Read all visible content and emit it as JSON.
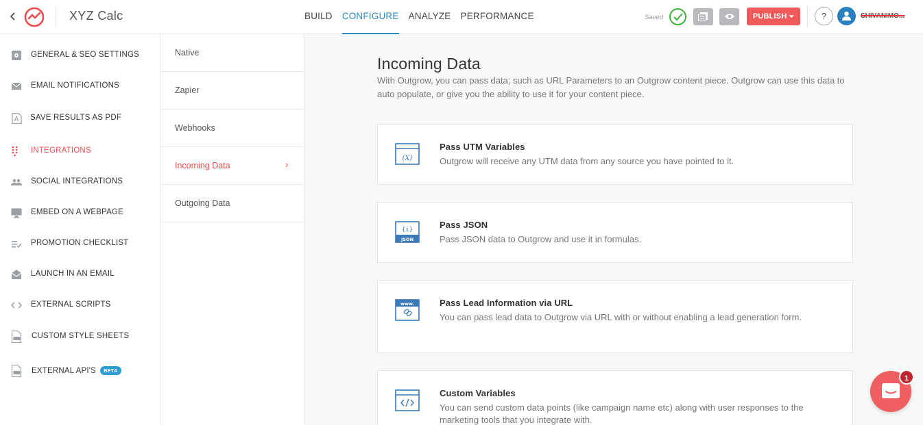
{
  "header": {
    "back_icon": "chevron-left-icon",
    "logo_icon": "outgrow-logo-icon",
    "app_title": "XYZ Calc",
    "tabs": [
      {
        "label": "BUILD",
        "active": false
      },
      {
        "label": "CONFIGURE",
        "active": true
      },
      {
        "label": "ANALYZE",
        "active": false
      },
      {
        "label": "PERFORMANCE",
        "active": false
      }
    ],
    "saved_label": "Saved",
    "publish_label": "PUBLISH",
    "help_label": "?",
    "username": "SHIVANIMO..."
  },
  "sidebar": {
    "items": [
      {
        "label": "GENERAL & SEO SETTINGS",
        "icon": "settings-icon"
      },
      {
        "label": "EMAIL NOTIFICATIONS",
        "icon": "envelope-icon"
      },
      {
        "label": "SAVE RESULTS AS PDF",
        "icon": "pdf-icon"
      },
      {
        "label": "INTEGRATIONS",
        "icon": "dots-grid-icon",
        "active": true
      },
      {
        "label": "SOCIAL INTEGRATIONS",
        "icon": "people-icon"
      },
      {
        "label": "EMBED ON A WEBPAGE",
        "icon": "monitor-icon"
      },
      {
        "label": "PROMOTION CHECKLIST",
        "icon": "checklist-icon"
      },
      {
        "label": "LAUNCH IN AN EMAIL",
        "icon": "open-envelope-icon"
      },
      {
        "label": "EXTERNAL SCRIPTS",
        "icon": "code-icon"
      },
      {
        "label": "CUSTOM STYLE SHEETS",
        "icon": "css-file-icon"
      },
      {
        "label": "EXTERNAL API'S",
        "icon": "api-file-icon",
        "badge": "BETA"
      }
    ]
  },
  "subnav": {
    "items": [
      {
        "label": "Native"
      },
      {
        "label": "Zapier"
      },
      {
        "label": "Webhooks"
      },
      {
        "label": "Incoming Data",
        "active": true
      },
      {
        "label": "Outgoing Data"
      }
    ]
  },
  "main": {
    "title": "Incoming Data",
    "description": "With Outgrow, you can pass data, such as URL Parameters to an Outgrow content piece. Outgrow can use this data to auto populate, or give you the ability to use it for your content piece.",
    "cards": [
      {
        "title": "Pass UTM Variables",
        "desc": "Outgrow will receive any UTM data from any source you have pointed to it.",
        "icon": "variable-window-icon",
        "icon_text": "(X)"
      },
      {
        "title": "Pass JSON",
        "desc": "Pass JSON data to Outgrow and use it in formulas.",
        "icon": "json-icon",
        "icon_text": "{i}",
        "icon_caption": "JSON"
      },
      {
        "title": "Pass Lead Information via URL",
        "desc": "You can pass lead data to Outgrow via URL with or without enabling a lead generation form.",
        "icon": "www-link-icon",
        "icon_text": "www."
      },
      {
        "title": "Custom Variables",
        "desc": "You can send custom data points (like campaign name etc) along with user responses to the marketing tools that you integrate with.",
        "icon": "code-window-icon"
      }
    ]
  },
  "chat": {
    "icon": "chat-icon",
    "badge": "1"
  },
  "colors": {
    "accent_blue": "#2a8ac4",
    "accent_red": "#ef4d4d",
    "publish": "#ef5a5a",
    "saved_green": "#3db33d"
  }
}
